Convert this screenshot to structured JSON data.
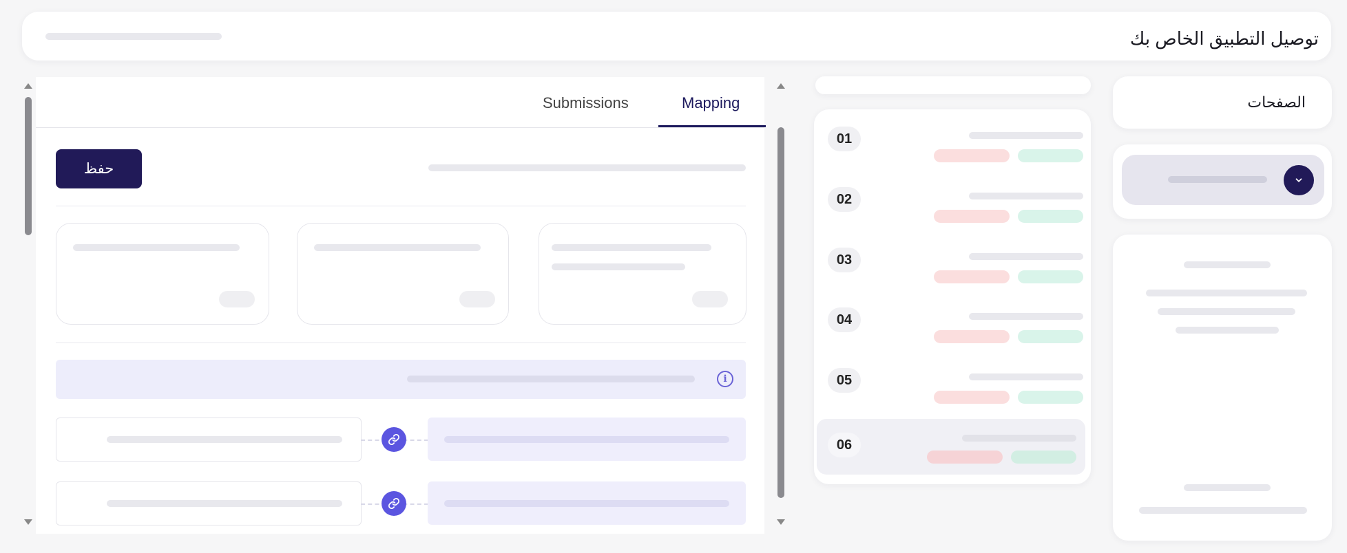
{
  "header": {
    "title": "توصيل التطبيق الخاص بك"
  },
  "tabs": [
    {
      "label": "Mapping",
      "active": true
    },
    {
      "label": "Submissions",
      "active": false
    }
  ],
  "toolbar": {
    "save_label": "حفظ"
  },
  "info_banner": {
    "icon": "info-icon"
  },
  "mapping_rows": [
    {
      "link_icon": "link-icon"
    },
    {
      "link_icon": "link-icon"
    }
  ],
  "pages_list": {
    "items": [
      {
        "number": "01",
        "selected": false
      },
      {
        "number": "02",
        "selected": false
      },
      {
        "number": "03",
        "selected": false
      },
      {
        "number": "04",
        "selected": false
      },
      {
        "number": "05",
        "selected": false
      },
      {
        "number": "06",
        "selected": true
      }
    ]
  },
  "sidebar": {
    "title": "الصفحات",
    "dropdown_icon": "chevron-down-icon"
  },
  "colors": {
    "accent": "#211a58",
    "link": "#5b55e0",
    "tab_active": "#1e1b5e"
  }
}
